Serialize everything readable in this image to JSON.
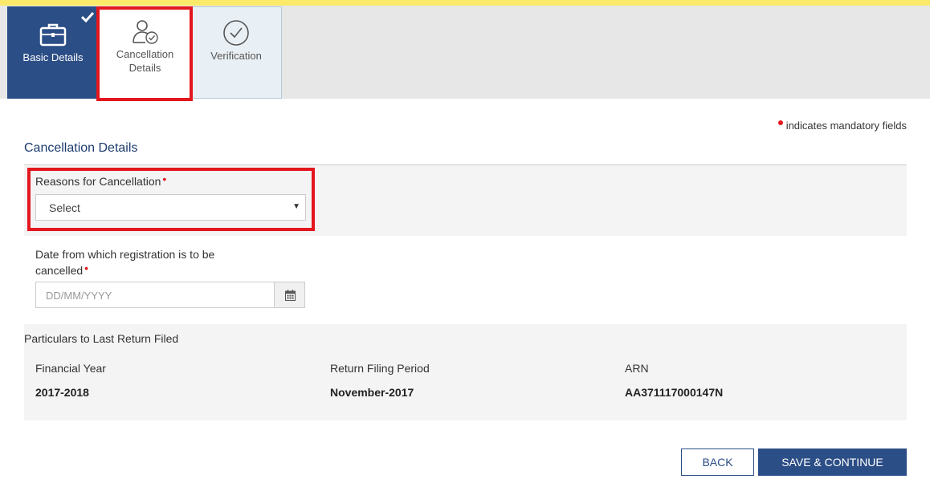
{
  "tabs": {
    "basic": {
      "label": "Basic Details",
      "status": "completed"
    },
    "cancellation": {
      "label_line1": "Cancellation",
      "label_line2": "Details"
    },
    "verification": {
      "label": "Verification"
    }
  },
  "mandatory_note": "indicates mandatory fields",
  "section_title": "Cancellation Details",
  "reason_field": {
    "label": "Reasons for Cancellation",
    "required_mark": "•",
    "value": "Select"
  },
  "date_field": {
    "label_line1": "Date from which registration is to be",
    "label_line2": "cancelled",
    "required_mark": "•",
    "placeholder": "DD/MM/YYYY"
  },
  "last_return": {
    "title": "Particulars to Last Return Filed",
    "columns": [
      {
        "header": "Financial Year",
        "value": "2017-2018"
      },
      {
        "header": "Return Filing Period",
        "value": "November-2017"
      },
      {
        "header": "ARN",
        "value": "AA371117000147N"
      }
    ]
  },
  "buttons": {
    "back": "BACK",
    "save": "SAVE & CONTINUE"
  },
  "colors": {
    "primary": "#2c4e86",
    "highlight": "#e4161e",
    "top_strip": "#fbe96a"
  }
}
